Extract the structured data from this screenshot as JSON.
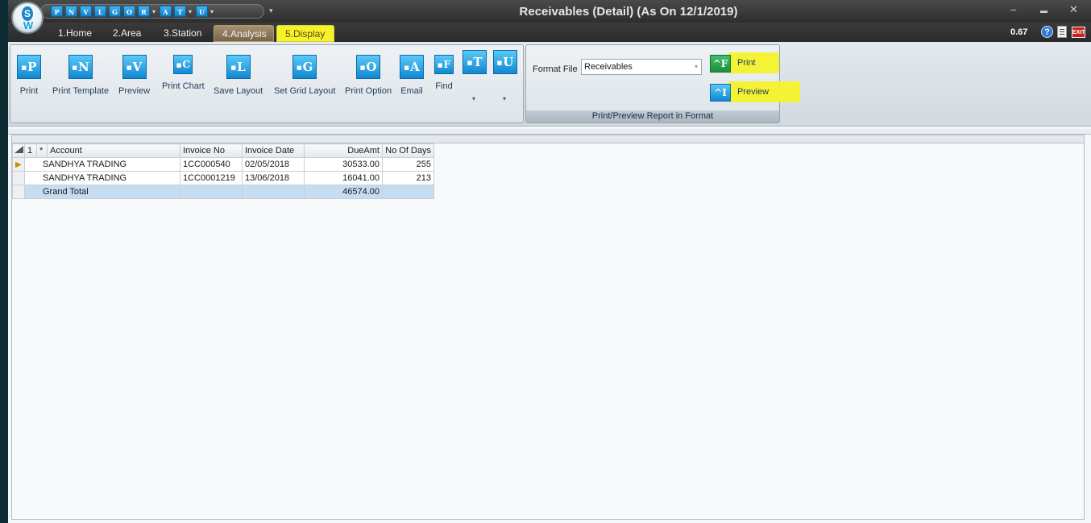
{
  "window": {
    "title": "Receivables (Detail) (As On 12/1/2019)",
    "minimize": "–",
    "restore": "▬",
    "close": "✕"
  },
  "logo": {
    "letter": "S",
    "mark": "W"
  },
  "quick_access": [
    {
      "letter": "P",
      "icon": "print-icon"
    },
    {
      "letter": "N",
      "icon": "print-template-icon"
    },
    {
      "letter": "V",
      "icon": "preview-icon"
    },
    {
      "letter": "L",
      "icon": "save-layout-icon"
    },
    {
      "letter": "G",
      "icon": "set-grid-layout-icon"
    },
    {
      "letter": "O",
      "icon": "print-option-icon"
    },
    {
      "letter": "R",
      "icon": "r-icon",
      "dropdown": true
    },
    {
      "letter": "A",
      "icon": "email-icon"
    },
    {
      "letter": "T",
      "icon": "t-icon",
      "dropdown": true
    },
    {
      "letter": "U",
      "icon": "u-icon",
      "dropdown": true
    }
  ],
  "tabs": [
    {
      "label": "1.Home"
    },
    {
      "label": "2.Area"
    },
    {
      "label": "3.Station"
    },
    {
      "label": "4.Analysis"
    },
    {
      "label": "5.Display"
    }
  ],
  "status": {
    "zoom": "0.67",
    "help": "?",
    "exit": "EXIT"
  },
  "ribbon": {
    "buttons": [
      {
        "letter": "P",
        "label": "Print",
        "icon": "print-icon"
      },
      {
        "letter": "N",
        "label": "Print Template",
        "icon": "print-template-icon"
      },
      {
        "letter": "V",
        "label": "Preview",
        "icon": "preview-icon"
      },
      {
        "letter": "C",
        "label": "Print Chart",
        "icon": "print-chart-icon"
      },
      {
        "letter": "L",
        "label": "Save Layout",
        "icon": "save-layout-icon"
      },
      {
        "letter": "G",
        "label": "Set Grid Layout",
        "icon": "set-grid-layout-icon"
      },
      {
        "letter": "O",
        "label": "Print Option",
        "icon": "print-option-icon"
      },
      {
        "letter": "A",
        "label": "Email",
        "icon": "email-icon"
      },
      {
        "letter": "F",
        "label": "Find",
        "icon": "find-icon"
      },
      {
        "letter": "T",
        "label": "",
        "icon": "t-icon"
      },
      {
        "letter": "U",
        "label": "",
        "icon": "u-icon"
      }
    ],
    "format_group": {
      "label": "Format File",
      "selected": "Receivables",
      "print_label": "Print",
      "print_key": "^F",
      "preview_label": "Preview",
      "preview_key": "^I",
      "footer": "Print/Preview Report in Format"
    }
  },
  "grid": {
    "columns": [
      "1",
      "*",
      "Account",
      "Invoice No",
      "Invoice Date",
      "DueAmt",
      "No Of Days"
    ],
    "rows": [
      {
        "account": "SANDHYA TRADING",
        "invoice_no": "1CC000540",
        "invoice_date": "02/05/2018",
        "due_amt": "30533.00",
        "days": "255"
      },
      {
        "account": "SANDHYA TRADING",
        "invoice_no": "1CC0001219",
        "invoice_date": "13/06/2018",
        "due_amt": "16041.00",
        "days": "213"
      }
    ],
    "total": {
      "label": "Grand Total",
      "due_amt": "46574.00"
    }
  }
}
